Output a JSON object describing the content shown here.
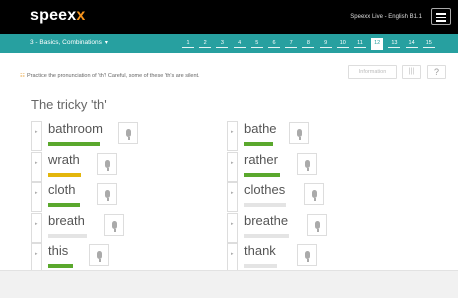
{
  "header": {
    "logo": "speexx",
    "course": "Speexx Live - English B1.1"
  },
  "lesson": {
    "name": "3 - Basics, Combinations",
    "chevron": "▾",
    "pages": [
      "1",
      "2",
      "3",
      "4",
      "5",
      "6",
      "7",
      "8",
      "9",
      "10",
      "11",
      "12",
      "13",
      "14",
      "15"
    ],
    "active_page": "12"
  },
  "instructions": {
    "flag": "☷",
    "text": "Practice the pronunciation of 'th'! Careful, some of these 'th's are silent."
  },
  "tools": {
    "info": "Information",
    "stats": "|||",
    "help": "?"
  },
  "exercise": {
    "title": "The tricky 'th'",
    "speaker_icon": "▸",
    "left": [
      {
        "word": "bathroom",
        "status": "green"
      },
      {
        "word": "wrath",
        "status": "yellow"
      },
      {
        "word": "cloth",
        "status": "green"
      },
      {
        "word": "breath",
        "status": "grey"
      },
      {
        "word": "this",
        "status": "green"
      }
    ],
    "right": [
      {
        "word": "bathe",
        "status": "green"
      },
      {
        "word": "rather",
        "status": "green"
      },
      {
        "word": "clothes",
        "status": "grey"
      },
      {
        "word": "breathe",
        "status": "grey"
      },
      {
        "word": "thank",
        "status": "grey"
      }
    ]
  },
  "colors": {
    "accent": "#27a0a0",
    "logo_x": "#f7941d",
    "good": "#5aa82d",
    "partial": "#e3b60c",
    "pending": "#e4e4e4"
  }
}
